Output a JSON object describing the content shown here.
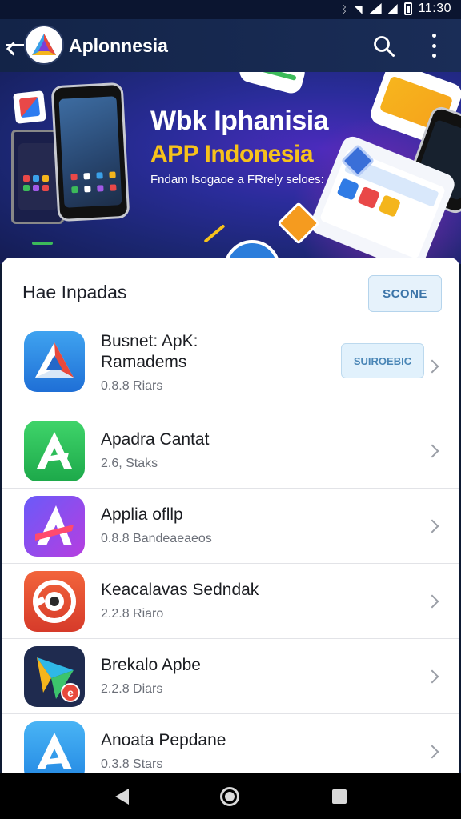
{
  "status_bar": {
    "time": "11:30"
  },
  "app_bar": {
    "title": "Aplonnesia"
  },
  "banner": {
    "line1": "Wbk Iphanisia",
    "line2": "APP Indonesia",
    "line3": "Fndam Isogaoe a FRrely seloes:"
  },
  "section": {
    "title": "Hae Inpadas",
    "button_label": "SCONE"
  },
  "apps": [
    {
      "name_line1": "Busnet: ApK:",
      "name_line2": "Ramadems",
      "meta": "0.8.8 Riars",
      "action_label": "SUIROEBIC",
      "icon": "blue-triangle-icon"
    },
    {
      "name_line1": "Apadra Cantat",
      "name_line2": "",
      "meta": "2.6, Staks",
      "icon": "green-a-icon"
    },
    {
      "name_line1": "Applia ofllp",
      "name_line2": "",
      "meta": "0.8.8 Bandeaeaeos",
      "icon": "purple-a-icon"
    },
    {
      "name_line1": "Keacalavas Sedndak",
      "name_line2": "",
      "meta": "2.2.8 Riaro",
      "icon": "red-camera-icon"
    },
    {
      "name_line1": "Brekalo Apbe",
      "name_line2": "",
      "meta": "2.2.8 Diars",
      "icon": "dark-play-icon"
    },
    {
      "name_line1": "Anoata Pepdane",
      "name_line2": "",
      "meta": "0.3.8 Stars",
      "icon": "blue-a-icon"
    }
  ],
  "colors": {
    "app_bar": "#132448",
    "banner_bg": "#2a2c9a",
    "accent_yellow": "#f7c21b",
    "button_bg": "#e6f2fb",
    "button_text": "#3b74a8"
  }
}
